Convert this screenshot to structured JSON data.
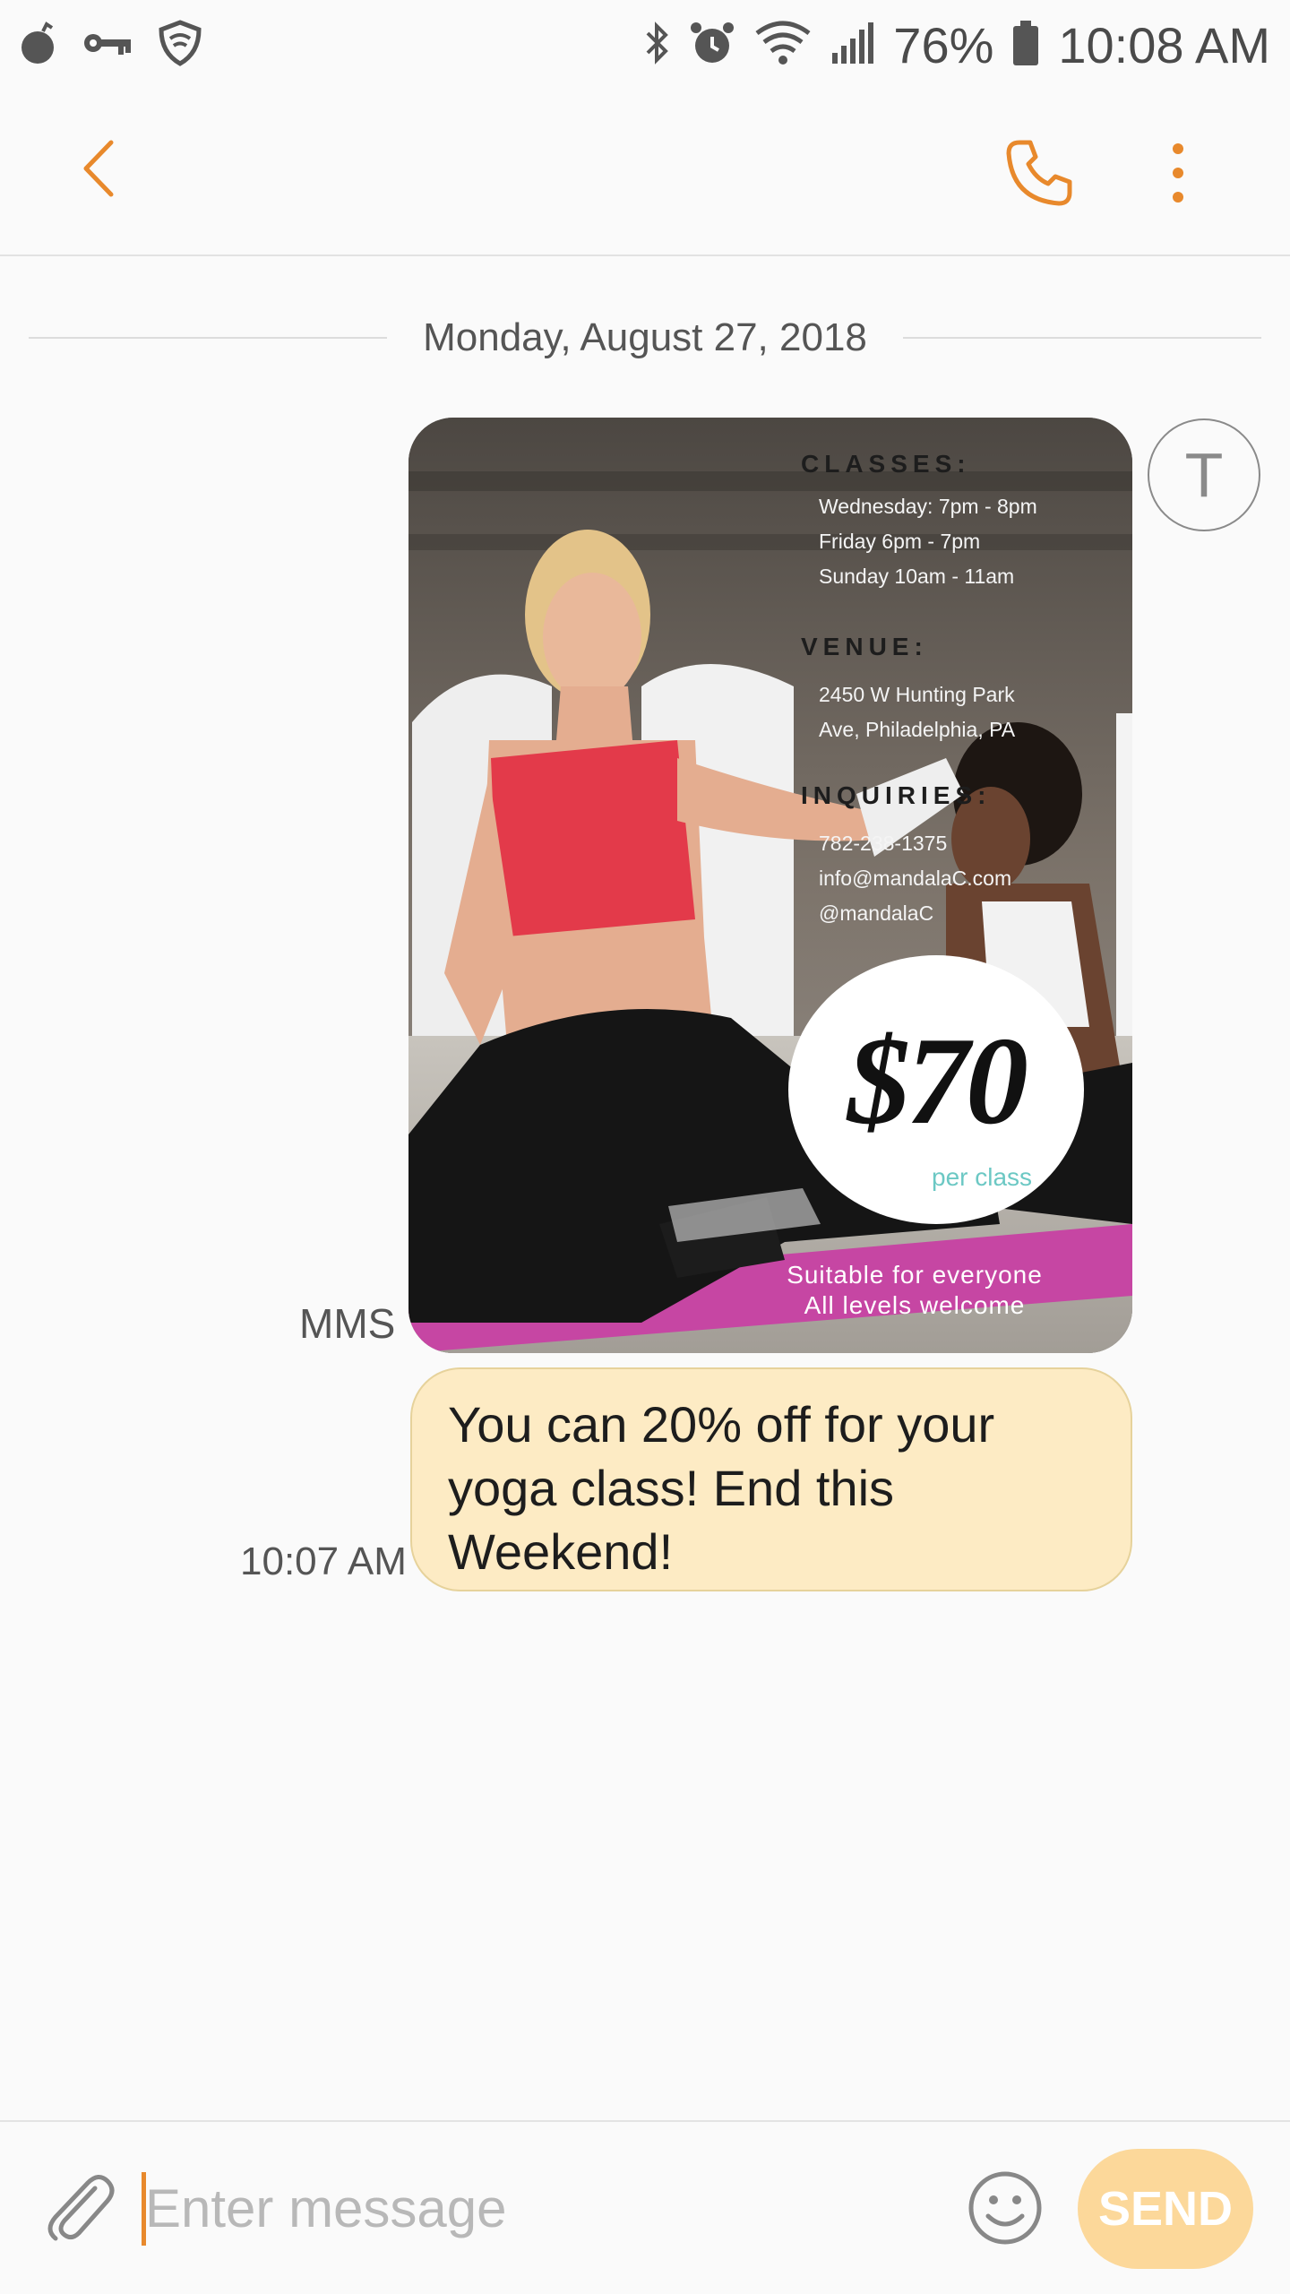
{
  "status_bar": {
    "icons_left": [
      "bomb-icon",
      "key-icon",
      "shield-icon"
    ],
    "icons_right": [
      "bluetooth-icon",
      "alarm-icon",
      "wifi-icon",
      "signal-icon"
    ],
    "battery": "76%",
    "time": "10:08 AM"
  },
  "action_bar": {
    "back_icon": "chevron-left-icon",
    "call_icon": "phone-icon",
    "more_icon": "more-vertical-icon",
    "accent_color": "#e8892c"
  },
  "conversation": {
    "date": "Monday, August 27, 2018",
    "contact_initial": "T",
    "messages": [
      {
        "type": "mms",
        "label": "MMS",
        "poster": {
          "classes_heading": "CLASSES:",
          "classes": [
            "Wednesday: 7pm - 8pm",
            "Friday 6pm - 7pm",
            "Sunday 10am - 11am"
          ],
          "venue_heading": "VENUE:",
          "venue": [
            "2450 W Hunting Park",
            "Ave, Philadelphia, PA"
          ],
          "inquiries_heading": "INQUIRIES:",
          "inquiries": [
            "782-238-1375",
            "info@mandalaC.com",
            "@mandalaC"
          ],
          "price": "$70",
          "price_unit": "per class",
          "footer": [
            "Suitable for everyone",
            "All levels welcome"
          ]
        }
      },
      {
        "type": "text",
        "text": "You can 20% off for your yoga class! End this Weekend!",
        "time": "10:07 AM",
        "bubble_color": "#fdebc4"
      }
    ]
  },
  "composer": {
    "placeholder": "Enter message",
    "send_label": "SEND",
    "attach_icon": "paperclip-icon",
    "emoji_icon": "smiley-icon"
  }
}
